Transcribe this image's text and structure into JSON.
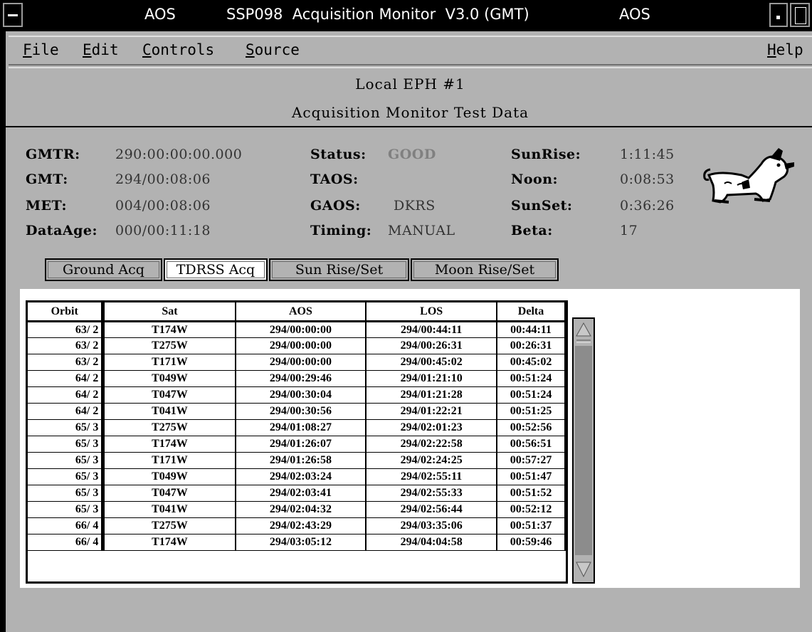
{
  "window": {
    "title_left": "AOS",
    "title_main": "SSP098  Acquisition Monitor  V3.0 (GMT)",
    "title_right": "AOS"
  },
  "menu": {
    "file": "ile",
    "file_key": "F",
    "edit": "dit",
    "edit_key": "E",
    "controls": "ontrols",
    "controls_key": "C",
    "source": "ource",
    "source_key": "S",
    "help": "elp",
    "help_key": "H"
  },
  "header": {
    "line1": "Local EPH #1",
    "line2": "Acquisition Monitor Test Data"
  },
  "info": {
    "gmtr_label": "GMTR:",
    "gmtr_value": "290:00:00:00.000",
    "gmt_label": "GMT:",
    "gmt_value": "294/00:08:06",
    "met_label": "MET:",
    "met_value": "004/00:08:06",
    "dataage_label": "DataAge:",
    "dataage_value": "000/00:11:18",
    "status_label": "Status:",
    "status_value": "GOOD",
    "taos_label": "TAOS:",
    "taos_value": "",
    "gaos_label": "GAOS:",
    "gaos_value": "DKRS",
    "timing_label": "Timing:",
    "timing_value": "MANUAL",
    "sunrise_label": "SunRise:",
    "sunrise_value": "1:11:45",
    "noon_label": "Noon:",
    "noon_value": "0:08:53",
    "sunset_label": "SunSet:",
    "sunset_value": "0:36:26",
    "beta_label": "Beta:",
    "beta_value": "17"
  },
  "tabs": {
    "ground": "Ground Acq",
    "tdrss": "TDRSS Acq",
    "sun": "Sun Rise/Set",
    "moon": "Moon Rise/Set",
    "active": "tdrss"
  },
  "table": {
    "columns": [
      "Orbit",
      "Sat",
      "AOS",
      "LOS",
      "Delta"
    ],
    "rows": [
      [
        "63/ 2",
        "T174W",
        "294/00:00:00",
        "294/00:44:11",
        "00:44:11"
      ],
      [
        "63/ 2",
        "T275W",
        "294/00:00:00",
        "294/00:26:31",
        "00:26:31"
      ],
      [
        "63/ 2",
        "T171W",
        "294/00:00:00",
        "294/00:45:02",
        "00:45:02"
      ],
      [
        "64/ 2",
        "T049W",
        "294/00:29:46",
        "294/01:21:10",
        "00:51:24"
      ],
      [
        "64/ 2",
        "T047W",
        "294/00:30:04",
        "294/01:21:28",
        "00:51:24"
      ],
      [
        "64/ 2",
        "T041W",
        "294/00:30:56",
        "294/01:22:21",
        "00:51:25"
      ],
      [
        "65/ 3",
        "T275W",
        "294/01:08:27",
        "294/02:01:23",
        "00:52:56"
      ],
      [
        "65/ 3",
        "T174W",
        "294/01:26:07",
        "294/02:22:58",
        "00:56:51"
      ],
      [
        "65/ 3",
        "T171W",
        "294/01:26:58",
        "294/02:24:25",
        "00:57:27"
      ],
      [
        "65/ 3",
        "T049W",
        "294/02:03:24",
        "294/02:55:11",
        "00:51:47"
      ],
      [
        "65/ 3",
        "T047W",
        "294/02:03:41",
        "294/02:55:33",
        "00:51:52"
      ],
      [
        "65/ 3",
        "T041W",
        "294/02:04:32",
        "294/02:56:44",
        "00:52:12"
      ],
      [
        "66/ 4",
        "T275W",
        "294/02:43:29",
        "294/03:35:06",
        "00:51:37"
      ],
      [
        "66/ 4",
        "T174W",
        "294/03:05:12",
        "294/04:04:58",
        "00:59:46"
      ]
    ]
  },
  "colors": {
    "window_bg": "#b2b2b2",
    "titlebar": "#000000",
    "status_good": "#808080"
  }
}
